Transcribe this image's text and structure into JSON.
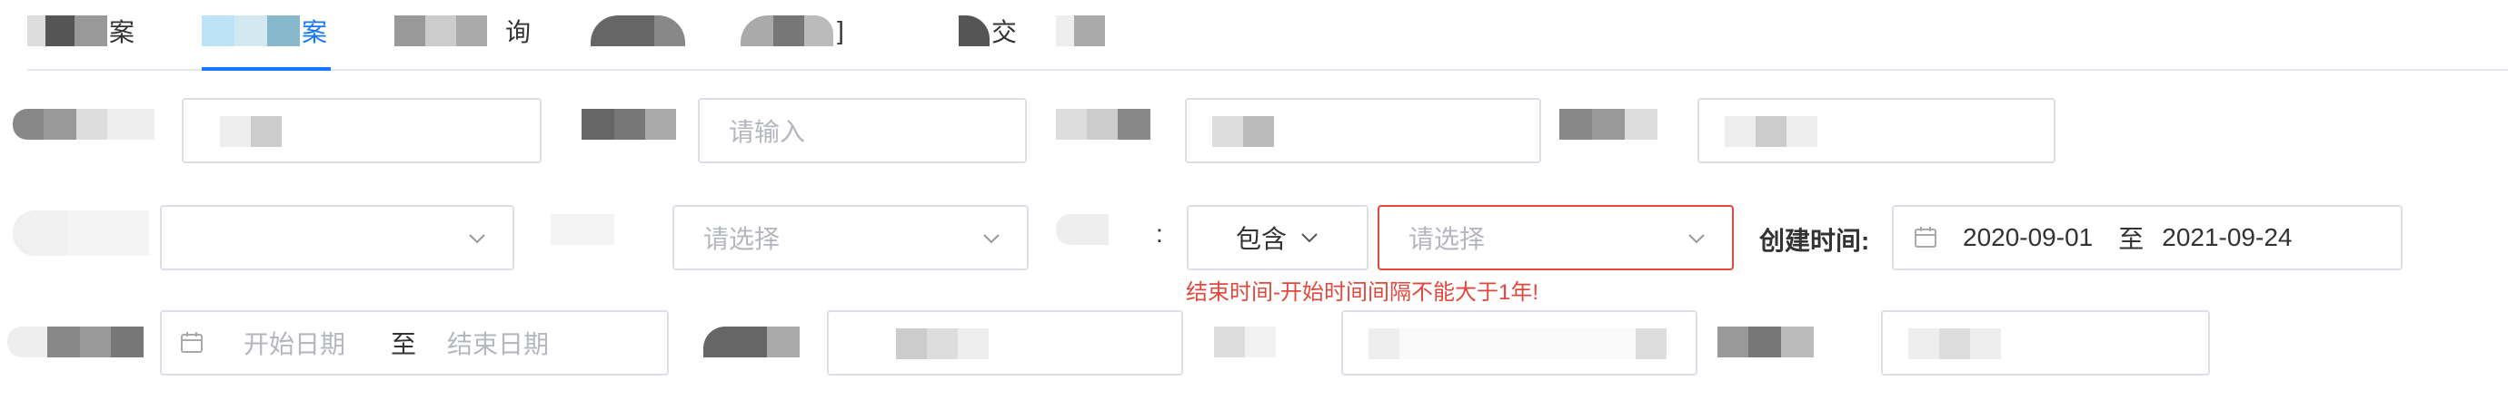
{
  "tabs": {
    "items": [
      {
        "label": "案"
      },
      {
        "label": "案"
      },
      {
        "label": "询"
      },
      {
        "label": ""
      },
      {
        "label": "]"
      },
      {
        "label": "交"
      },
      {
        "label": ""
      }
    ]
  },
  "row1": {
    "input2_placeholder": "请输入"
  },
  "row2": {
    "select1_placeholder": "",
    "select2_placeholder": "请选择",
    "colon": ":",
    "contains_label": "包含",
    "select3_placeholder": "请选择",
    "created_label": "创建时间:",
    "created_start": "2020-09-01",
    "created_to": "至",
    "created_end": "2021-09-24",
    "error_text": "结束时间-开始时间间隔不能大于1年!"
  },
  "row3": {
    "start_placeholder": "开始日期",
    "to": "至",
    "end_placeholder": "结束日期"
  },
  "colors": {
    "accent": "#1677ff",
    "error": "#e2483d",
    "border": "#dcdfe6"
  }
}
